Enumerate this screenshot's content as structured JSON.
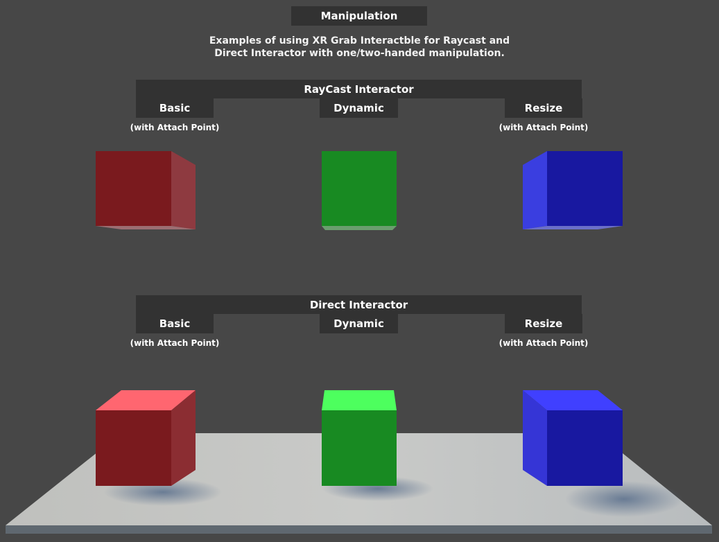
{
  "header": {
    "title": "Manipulation",
    "description_line1": "Examples of using XR Grab Interactble for Raycast and",
    "description_line2": "Direct Interactor with one/two-handed manipulation."
  },
  "raycast_section": {
    "title": "RayCast Interactor",
    "basic": {
      "label": "Basic",
      "note": "(with Attach Point)"
    },
    "dynamic": {
      "label": "Dynamic"
    },
    "resize": {
      "label": "Resize",
      "note": "(with Attach Point)"
    }
  },
  "direct_section": {
    "title": "Direct Interactor",
    "basic": {
      "label": "Basic",
      "note": "(with Attach Point)"
    },
    "dynamic": {
      "label": "Dynamic"
    },
    "resize": {
      "label": "Resize",
      "note": "(with Attach Point)"
    }
  },
  "colors": {
    "background": "#474747",
    "panel": "#323232",
    "cube_red_front": "#7a1a1e",
    "cube_red_top": "#ff6670",
    "cube_green_front": "#188a22",
    "cube_green_top": "#4dff5e",
    "cube_blue_front": "#1818a0",
    "cube_blue_top": "#4040ff",
    "floor": "#c6c7c5"
  }
}
